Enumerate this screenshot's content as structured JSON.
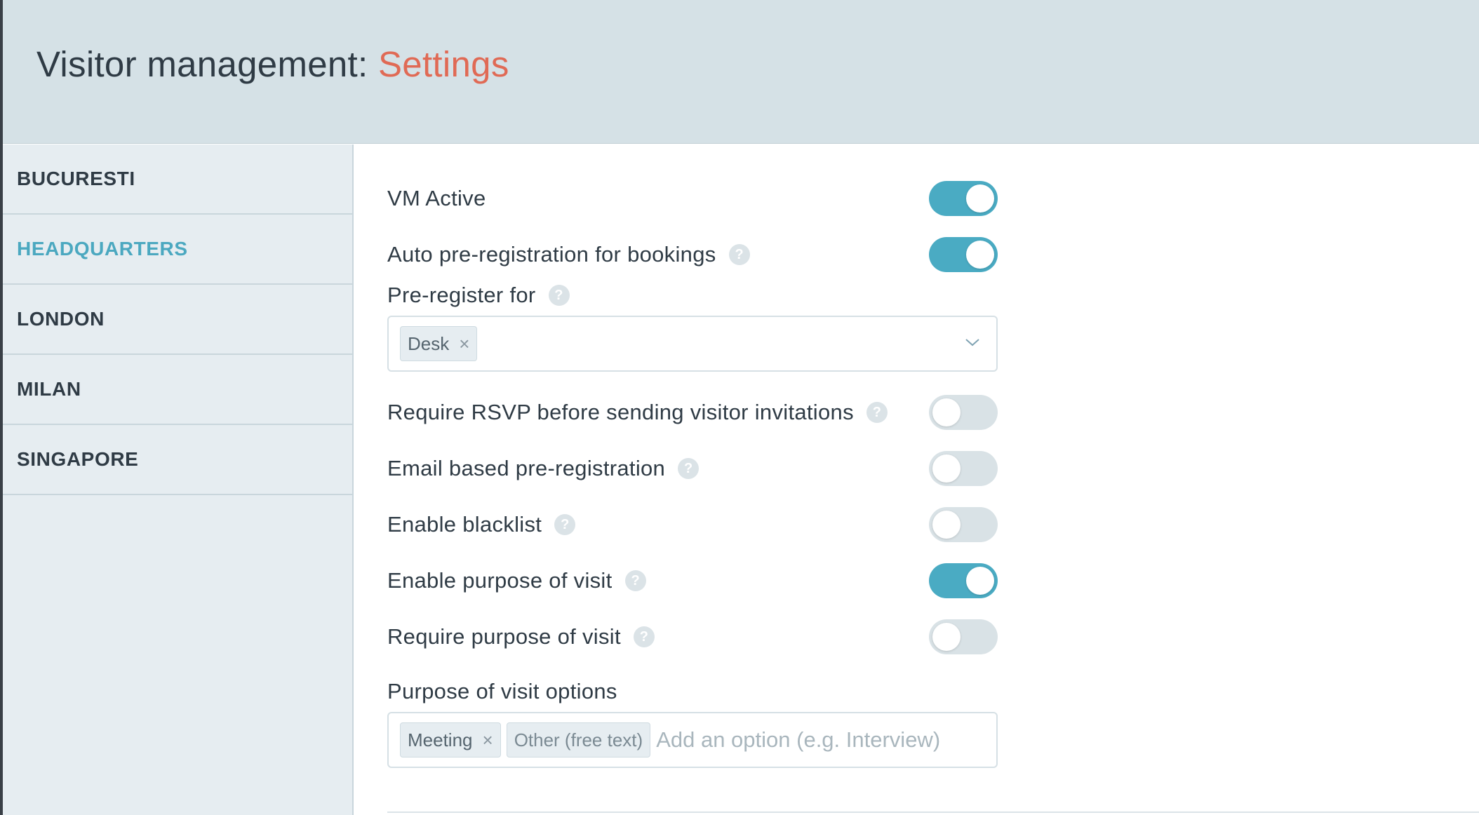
{
  "header": {
    "title_prefix": "Visitor management: ",
    "title_accent": "Settings",
    "accent_color": "#e06a55",
    "background_color": "#d5e1e6"
  },
  "sidebar": {
    "items": [
      {
        "label": "BUCURESTI",
        "active": false
      },
      {
        "label": "HEADQUARTERS",
        "active": true
      },
      {
        "label": "LONDON",
        "active": false
      },
      {
        "label": "MILAN",
        "active": false
      },
      {
        "label": "SINGAPORE",
        "active": false
      }
    ],
    "active_color": "#4ba8c0"
  },
  "settings": {
    "vm_active": {
      "label": "VM Active",
      "enabled": true
    },
    "auto_preregistration": {
      "label": "Auto pre-registration for bookings",
      "enabled": true
    },
    "preregister_for": {
      "label": "Pre-register for",
      "selected": [
        "Desk"
      ]
    },
    "require_rsvp": {
      "label": "Require RSVP before sending visitor invitations",
      "enabled": false
    },
    "email_preregistration": {
      "label": "Email based pre-registration",
      "enabled": false
    },
    "enable_blacklist": {
      "label": "Enable blacklist",
      "enabled": false
    },
    "enable_purpose": {
      "label": "Enable purpose of visit",
      "enabled": true
    },
    "require_purpose": {
      "label": "Require purpose of visit",
      "enabled": false
    },
    "purpose_options": {
      "label": "Purpose of visit options",
      "options": [
        "Meeting"
      ],
      "fixed_option": "Other (free text)",
      "placeholder": "Add an option (e.g. Interview)"
    }
  },
  "icons": {
    "help": "?",
    "remove": "×",
    "dropdown": "chevron-down-icon"
  },
  "toggle_on_color": "#4aabc3",
  "toggle_off_color": "#d9e2e6"
}
